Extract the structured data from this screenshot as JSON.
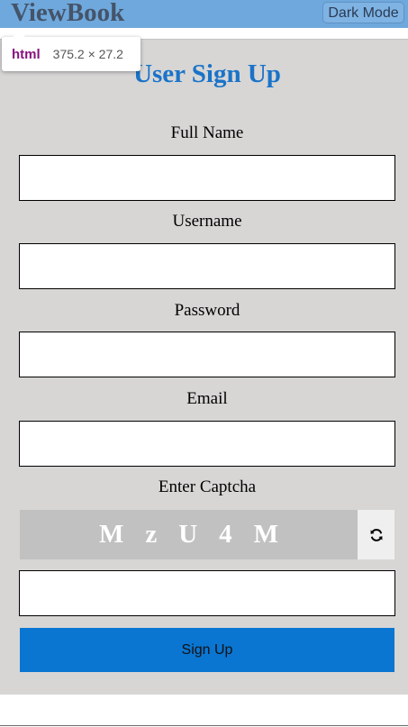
{
  "header": {
    "brand": "ViewBook",
    "dark_mode_label": "Dark Mode"
  },
  "devtools_tooltip": {
    "tag": "html",
    "size": "375.2 × 27.2"
  },
  "form": {
    "title": "User Sign Up",
    "full_name_label": "Full Name",
    "full_name_value": "",
    "username_label": "Username",
    "username_value": "",
    "password_label": "Password",
    "password_value": "",
    "email_label": "Email",
    "email_value": "",
    "captcha_label": "Enter Captcha",
    "captcha_chars": [
      "M",
      "z",
      "U",
      "4",
      "M"
    ],
    "captcha_input_value": "",
    "refresh_icon": "refresh-icon",
    "submit_label": "Sign Up"
  },
  "colors": {
    "header_bg": "#6fa8dc",
    "panel_bg": "#d7d6d5",
    "title": "#1a73c8",
    "button": "#0a76d2",
    "captcha_bg": "#c1c1c1"
  }
}
